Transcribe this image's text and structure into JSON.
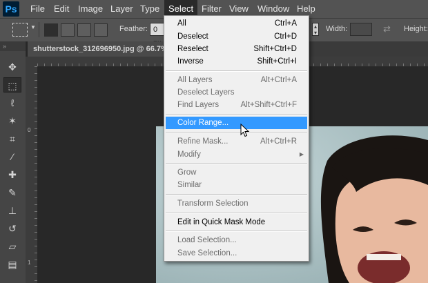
{
  "app": {
    "logo": "Ps"
  },
  "menubar": {
    "items": [
      "File",
      "Edit",
      "Image",
      "Layer",
      "Type",
      "Select",
      "Filter",
      "View",
      "Window",
      "Help"
    ]
  },
  "options": {
    "feather_label": "Feather:",
    "feather_value": "0 px",
    "width_label": "Width:",
    "height_label": "Height:"
  },
  "document": {
    "tab_title": "shutterstock_312696950.jpg @ 66.7% ("
  },
  "rulers": {
    "top_zero": "0",
    "left_zero": "0",
    "left_one": "1"
  },
  "select_menu": {
    "items": [
      {
        "label": "All",
        "shortcut": "Ctrl+A"
      },
      {
        "label": "Deselect",
        "shortcut": "Ctrl+D"
      },
      {
        "label": "Reselect",
        "shortcut": "Shift+Ctrl+D"
      },
      {
        "label": "Inverse",
        "shortcut": "Shift+Ctrl+I"
      },
      {
        "label": "All Layers",
        "shortcut": "Alt+Ctrl+A"
      },
      {
        "label": "Deselect Layers",
        "shortcut": ""
      },
      {
        "label": "Find Layers",
        "shortcut": "Alt+Shift+Ctrl+F"
      },
      {
        "label": "Color Range...",
        "shortcut": ""
      },
      {
        "label": "Refine Mask...",
        "shortcut": "Alt+Ctrl+R"
      },
      {
        "label": "Modify",
        "shortcut": ""
      },
      {
        "label": "Grow",
        "shortcut": ""
      },
      {
        "label": "Similar",
        "shortcut": ""
      },
      {
        "label": "Transform Selection",
        "shortcut": ""
      },
      {
        "label": "Edit in Quick Mask Mode",
        "shortcut": ""
      },
      {
        "label": "Load Selection...",
        "shortcut": ""
      },
      {
        "label": "Save Selection...",
        "shortcut": ""
      }
    ],
    "highlighted": "Color Range..."
  },
  "tools": [
    "move-tool",
    "marquee-tool",
    "lasso-tool",
    "magic-wand-tool",
    "crop-tool",
    "eyedropper-tool",
    "healing-tool",
    "brush-tool",
    "clone-stamp-tool",
    "history-brush-tool",
    "eraser-tool",
    "gradient-tool"
  ],
  "colors": {
    "accent": "#3399ff",
    "menubar": "#535353",
    "canvas": "#282828"
  }
}
